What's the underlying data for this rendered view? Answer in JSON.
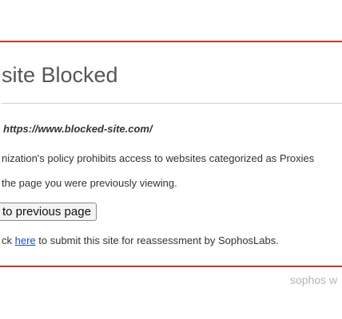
{
  "page": {
    "title": "site Blocked",
    "blocked_url": "https://www.blocked-site.com/",
    "policy_text": "nization's policy prohibits access to websites categorized as Proxies",
    "previous_text": "the page you were previously viewing.",
    "back_button_label": "to previous page",
    "reassess_prefix": "ck ",
    "reassess_link": "here",
    "reassess_suffix": " to submit this site for reassessment by SophosLabs."
  },
  "footer": {
    "brand_text": "sophos w"
  },
  "colors": {
    "border_accent": "#c0392b",
    "link": "#1a4fb5"
  }
}
